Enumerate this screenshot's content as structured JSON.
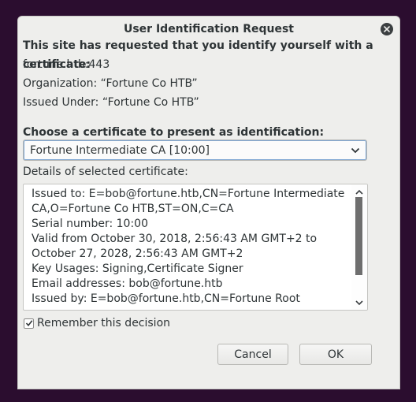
{
  "dialog": {
    "title": "User Identification Request",
    "request_heading": "This site has requested that you identify yourself with a certificate:",
    "host": "fortune.htb:443",
    "organization": "Organization: “Fortune Co HTB”",
    "issued_under": "Issued Under: “Fortune Co HTB”",
    "choose_heading": "Choose a certificate to present as identification:",
    "selected_certificate": "Fortune Intermediate CA [10:00]",
    "details_label": "Details of selected certificate:",
    "details_text": "Issued to: E=bob@fortune.htb,CN=Fortune Intermediate CA,O=Fortune Co HTB,ST=ON,C=CA\nSerial number: 10:00\nValid from October 30, 2018, 2:56:43 AM GMT+2 to October 27, 2028, 2:56:43 AM GMT+2\nKey Usages: Signing,Certificate Signer\nEmail addresses: bob@fortune.htb\nIssued by: E=bob@fortune.htb,CN=Fortune Root",
    "remember_label": "Remember this decision",
    "remember_checked": true,
    "cancel_label": "Cancel",
    "ok_label": "OK"
  },
  "icons": {
    "close": "close-icon",
    "dropdown": "chevron-down-icon",
    "scroll_up": "chevron-up-icon",
    "scroll_down": "chevron-down-icon",
    "check": "check-icon"
  },
  "colors": {
    "desktop_background": "#2b0d2f",
    "dialog_background": "#eeeeec",
    "focus_ring": "#7ea6d3"
  }
}
